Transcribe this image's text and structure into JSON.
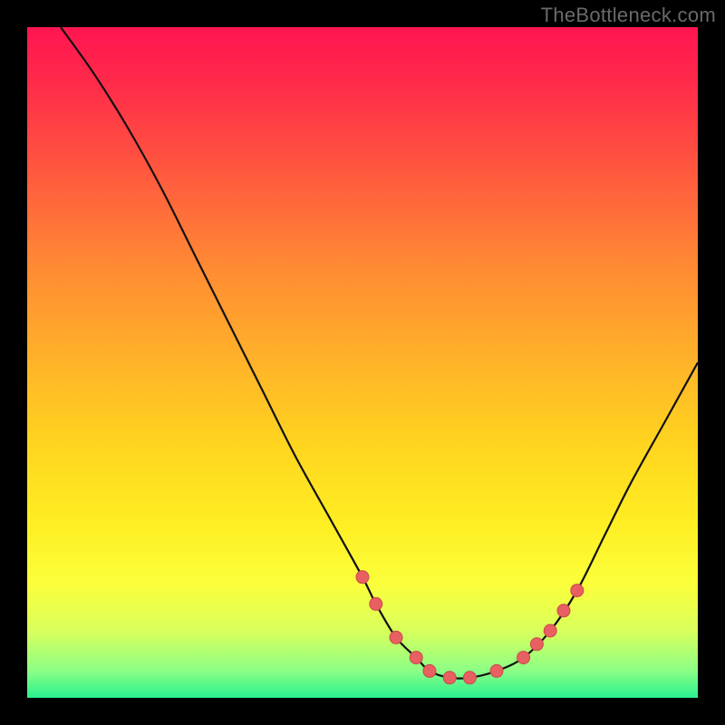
{
  "attribution": "TheBottleneck.com",
  "chart_data": {
    "type": "line",
    "title": "",
    "xlabel": "",
    "ylabel": "",
    "xlim": [
      0,
      100
    ],
    "ylim": [
      0,
      100
    ],
    "curve": {
      "x": [
        5,
        10,
        15,
        20,
        25,
        30,
        35,
        40,
        45,
        50,
        52,
        55,
        58,
        60,
        63,
        66,
        70,
        74,
        78,
        82,
        86,
        90,
        95,
        100
      ],
      "y": [
        100,
        93,
        85,
        76,
        66,
        56,
        46,
        36,
        27,
        18,
        14,
        9,
        6,
        4,
        3,
        3,
        4,
        6,
        10,
        16,
        24,
        32,
        41,
        50
      ]
    },
    "highlighted_points": {
      "x": [
        50,
        52,
        55,
        58,
        60,
        63,
        66,
        70,
        74,
        76,
        78,
        80,
        82
      ],
      "y": [
        18,
        14,
        9,
        6,
        4,
        3,
        3,
        4,
        6,
        8,
        10,
        13,
        16
      ]
    },
    "colors": {
      "curve": "#111111",
      "points_fill": "#e86061",
      "points_stroke": "#c84a4b",
      "gradient_top": "#ff1551",
      "gradient_bottom": "#29f08f"
    }
  }
}
